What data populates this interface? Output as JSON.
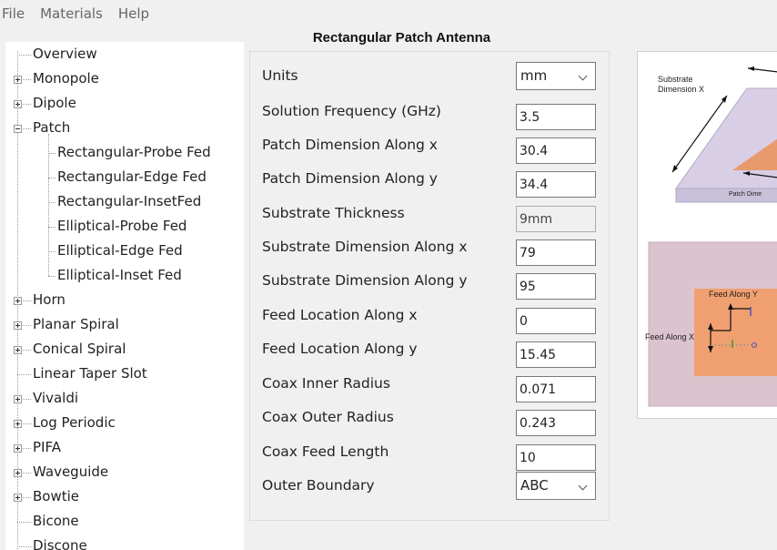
{
  "menu": [
    "File",
    "Materials",
    "Help"
  ],
  "tree": [
    {
      "label": "Overview",
      "level": 0,
      "expander": "none"
    },
    {
      "label": "Monopole",
      "level": 0,
      "expander": "plus"
    },
    {
      "label": "Dipole",
      "level": 0,
      "expander": "plus"
    },
    {
      "label": "Patch",
      "level": 0,
      "expander": "minus"
    },
    {
      "label": "Rectangular-Probe Fed",
      "level": 1,
      "expander": "none"
    },
    {
      "label": "Rectangular-Edge Fed",
      "level": 1,
      "expander": "none"
    },
    {
      "label": "Rectangular-InsetFed",
      "level": 1,
      "expander": "none"
    },
    {
      "label": "Elliptical-Probe Fed",
      "level": 1,
      "expander": "none"
    },
    {
      "label": "Elliptical-Edge Fed",
      "level": 1,
      "expander": "none"
    },
    {
      "label": "Elliptical-Inset Fed",
      "level": 1,
      "expander": "none"
    },
    {
      "label": "Horn",
      "level": 0,
      "expander": "plus"
    },
    {
      "label": "Planar Spiral",
      "level": 0,
      "expander": "plus"
    },
    {
      "label": "Conical Spiral",
      "level": 0,
      "expander": "plus"
    },
    {
      "label": "Linear Taper Slot",
      "level": 0,
      "expander": "none"
    },
    {
      "label": "Vivaldi",
      "level": 0,
      "expander": "plus"
    },
    {
      "label": "Log Periodic",
      "level": 0,
      "expander": "plus"
    },
    {
      "label": "PIFA",
      "level": 0,
      "expander": "plus"
    },
    {
      "label": "Waveguide",
      "level": 0,
      "expander": "plus"
    },
    {
      "label": "Bowtie",
      "level": 0,
      "expander": "plus"
    },
    {
      "label": "Bicone",
      "level": 0,
      "expander": "none"
    },
    {
      "label": "Discone",
      "level": 0,
      "expander": "none"
    }
  ],
  "panel": {
    "title": "Rectangular Patch Antenna",
    "fields": [
      {
        "label": "Units",
        "value": "mm",
        "kind": "select"
      },
      {
        "label": "Solution Frequency (GHz)",
        "value": "3.5",
        "kind": "input"
      },
      {
        "label": "Patch Dimension Along x",
        "value": "30.4",
        "kind": "input"
      },
      {
        "label": "Patch Dimension Along y",
        "value": "34.4",
        "kind": "input"
      },
      {
        "label": "Substrate Thickness",
        "value": "9mm",
        "kind": "disabled"
      },
      {
        "label": "Substrate Dimension Along x",
        "value": "79",
        "kind": "input"
      },
      {
        "label": "Substrate Dimension Along y",
        "value": "95",
        "kind": "input"
      },
      {
        "label": "Feed Location Along x",
        "value": "0",
        "kind": "input"
      },
      {
        "label": "Feed Location Along y",
        "value": "15.45",
        "kind": "input"
      },
      {
        "label": "Coax Inner Radius",
        "value": "0.071",
        "kind": "input"
      },
      {
        "label": "Coax Outer Radius",
        "value": "0.243",
        "kind": "input"
      },
      {
        "label": "Coax Feed Length",
        "value": "10",
        "kind": "input"
      },
      {
        "label": "Outer Boundary",
        "value": "ABC",
        "kind": "select"
      }
    ]
  },
  "diagram": {
    "substrate_label_1": "Substrate",
    "substrate_label_2": "Dimension X",
    "patch_label": "Patch Dime",
    "feed_y_label": "Feed Along Y",
    "feed_x_label": "Feed Along X",
    "colors": {
      "substrate": "#dcc4cf",
      "patch": "#f0a070",
      "substrate_3d": "#d8cfe6"
    }
  }
}
